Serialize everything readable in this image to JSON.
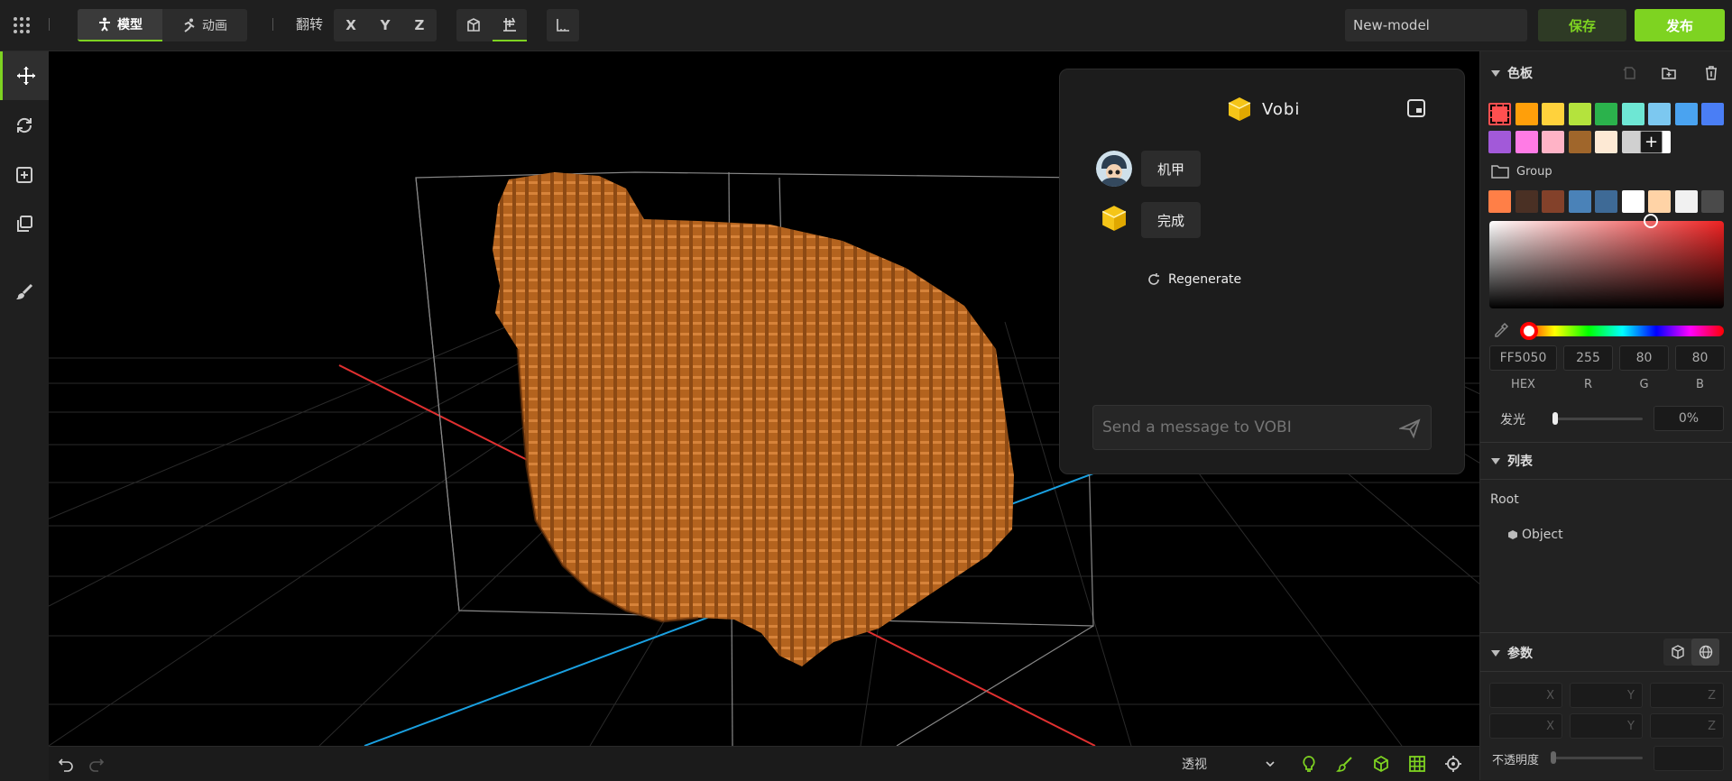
{
  "topbar": {
    "mode_tabs": [
      {
        "label": "模型"
      },
      {
        "label": "动画"
      }
    ],
    "flip_label": "翻转",
    "axes": [
      "X",
      "Y",
      "Z"
    ],
    "model_name": "New-model",
    "save_label": "保存",
    "publish_label": "发布",
    "accent_color": "#7ed321"
  },
  "chat": {
    "title": "Vobi",
    "user_message": "机甲",
    "bot_message": "完成",
    "regenerate_label": "Regenerate",
    "input_placeholder": "Send a message to VOBI"
  },
  "palette": {
    "title": "色板",
    "colors_row1": [
      "#ff5050",
      "#ff9f0a",
      "#ffd23c",
      "#b4e33d",
      "#2bb24c",
      "#6ee7d4",
      "#7cc8f0",
      "#4aa3f0",
      "#4a7ef5"
    ],
    "colors_row2": [
      "#a259d9",
      "#ff7be5",
      "#ffb3c6",
      "#a0662b",
      "#fde9d4",
      "#d0d0d0",
      "#ffffff"
    ],
    "group_label": "Group",
    "group_colors": [
      "#ff7f47",
      "#4a3024",
      "#83412a",
      "#4a82b8",
      "#3e6a96",
      "#ffffff",
      "#ffd3a6",
      "#f1f1f1",
      "#4a4a4a"
    ],
    "hex_value": "FF5050",
    "r_value": "255",
    "g_value": "80",
    "b_value": "80",
    "hex_label": "HEX",
    "r_label": "R",
    "g_label": "G",
    "b_label": "B",
    "glow_label": "发光",
    "glow_value": "0%"
  },
  "list": {
    "title": "列表",
    "root_label": "Root",
    "object_label": "Object"
  },
  "params": {
    "title": "参数",
    "axis_labels": [
      "X",
      "Y",
      "Z"
    ],
    "opacity_label": "不透明度"
  },
  "bottombar": {
    "view_mode": "透视"
  },
  "icons": [
    "grid-menu-icon",
    "person-icon",
    "running-icon",
    "move-icon",
    "rotate-icon",
    "add-icon",
    "duplicate-icon",
    "paint-brush-icon",
    "undo-icon",
    "redo-icon",
    "bulb-icon",
    "brush-icon",
    "cube-icon",
    "grid-icon",
    "target-icon",
    "eyedropper-icon",
    "send-icon"
  ]
}
